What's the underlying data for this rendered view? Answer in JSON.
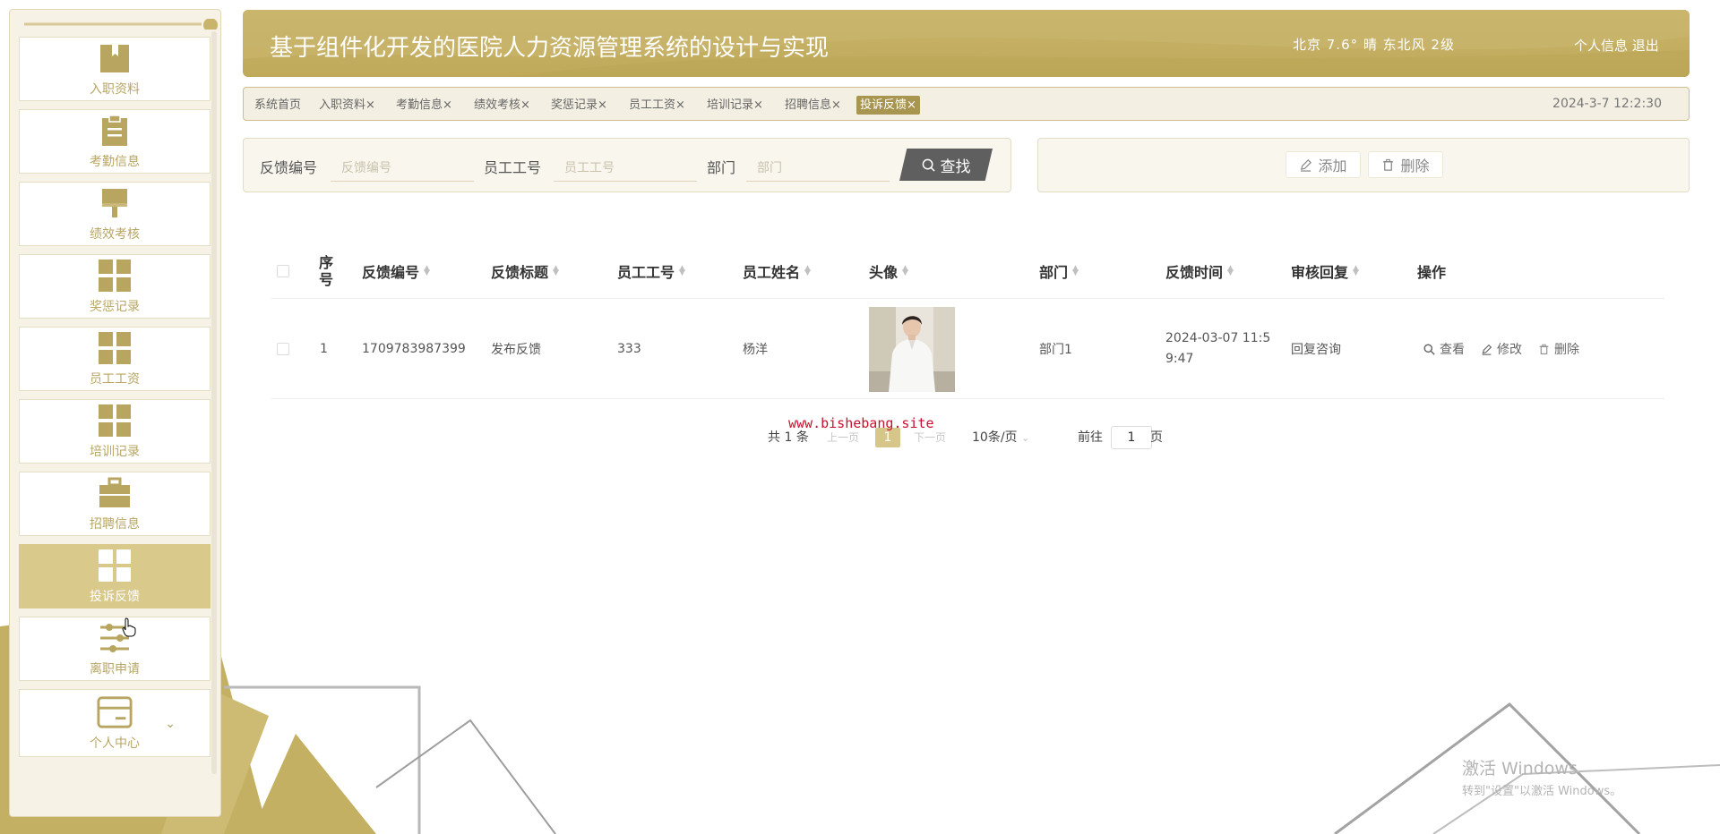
{
  "colors": {
    "accent": "#bfa95a",
    "accent_light": "#d9c98a",
    "accent_dark": "#a89550",
    "button_dark": "#5f5f5f"
  },
  "sidebar": {
    "items": [
      {
        "label": "入职资料",
        "icon": "book-icon",
        "active": false
      },
      {
        "label": "考勤信息",
        "icon": "clipboard-icon",
        "active": false
      },
      {
        "label": "绩效考核",
        "icon": "brush-icon",
        "active": false
      },
      {
        "label": "奖惩记录",
        "icon": "grid-icon",
        "active": false
      },
      {
        "label": "员工工资",
        "icon": "grid-icon",
        "active": false
      },
      {
        "label": "培训记录",
        "icon": "grid-icon",
        "active": false
      },
      {
        "label": "招聘信息",
        "icon": "briefcase-icon",
        "active": false
      },
      {
        "label": "投诉反馈",
        "icon": "grid-icon",
        "active": true
      },
      {
        "label": "离职申请",
        "icon": "sliders-icon",
        "active": false
      },
      {
        "label": "个人中心",
        "icon": "card-icon",
        "active": false
      }
    ]
  },
  "header": {
    "title": "基于组件化开发的医院人力资源管理系统的设计与实现",
    "weather": "北京 7.6° 晴 东北风 2级",
    "profile_label": "个人信息",
    "logout_label": "退出"
  },
  "tabs": {
    "items": [
      {
        "label": "系统首页",
        "closable": false
      },
      {
        "label": "入职资料",
        "closable": true
      },
      {
        "label": "考勤信息",
        "closable": true
      },
      {
        "label": "绩效考核",
        "closable": true
      },
      {
        "label": "奖惩记录",
        "closable": true
      },
      {
        "label": "员工工资",
        "closable": true
      },
      {
        "label": "培训记录",
        "closable": true
      },
      {
        "label": "招聘信息",
        "closable": true
      },
      {
        "label": "投诉反馈",
        "closable": true,
        "active": true
      }
    ],
    "close_glyph": "×",
    "datetime": "2024-3-7 12:2:30"
  },
  "search": {
    "fields": [
      {
        "label": "反馈编号",
        "placeholder": "反馈编号",
        "value": ""
      },
      {
        "label": "员工工号",
        "placeholder": "员工工号",
        "value": ""
      },
      {
        "label": "部门",
        "placeholder": "部门",
        "value": ""
      }
    ],
    "button_label": "查找"
  },
  "actions": {
    "add_label": "添加",
    "delete_label": "删除"
  },
  "table": {
    "columns": [
      "序号",
      "反馈编号",
      "反馈标题",
      "员工工号",
      "员工姓名",
      "头像",
      "部门",
      "反馈时间",
      "审核回复",
      "操作"
    ],
    "rows": [
      {
        "index": "1",
        "feedback_no": "1709783987399",
        "title": "发布反馈",
        "emp_no": "333",
        "emp_name": "杨洋",
        "dept": "部门1",
        "time_line1": "2024-03-07 11:5",
        "time_line2": "9:47",
        "reply": "回复咨询",
        "ops": {
          "view": "查看",
          "edit": "修改",
          "delete": "删除"
        }
      }
    ]
  },
  "pagination": {
    "total_prefix": "共",
    "total": "1",
    "total_suffix": "条",
    "prev": "上一页",
    "current": "1",
    "next": "下一页",
    "page_size": "10条/页",
    "goto_prefix": "前往",
    "goto_value": "1",
    "goto_suffix": "页"
  },
  "overlay": {
    "watermark": "www.bishebang.site",
    "windows_line1": "激活 Windows",
    "windows_line2": "转到\"设置\"以激活 Windows。"
  }
}
